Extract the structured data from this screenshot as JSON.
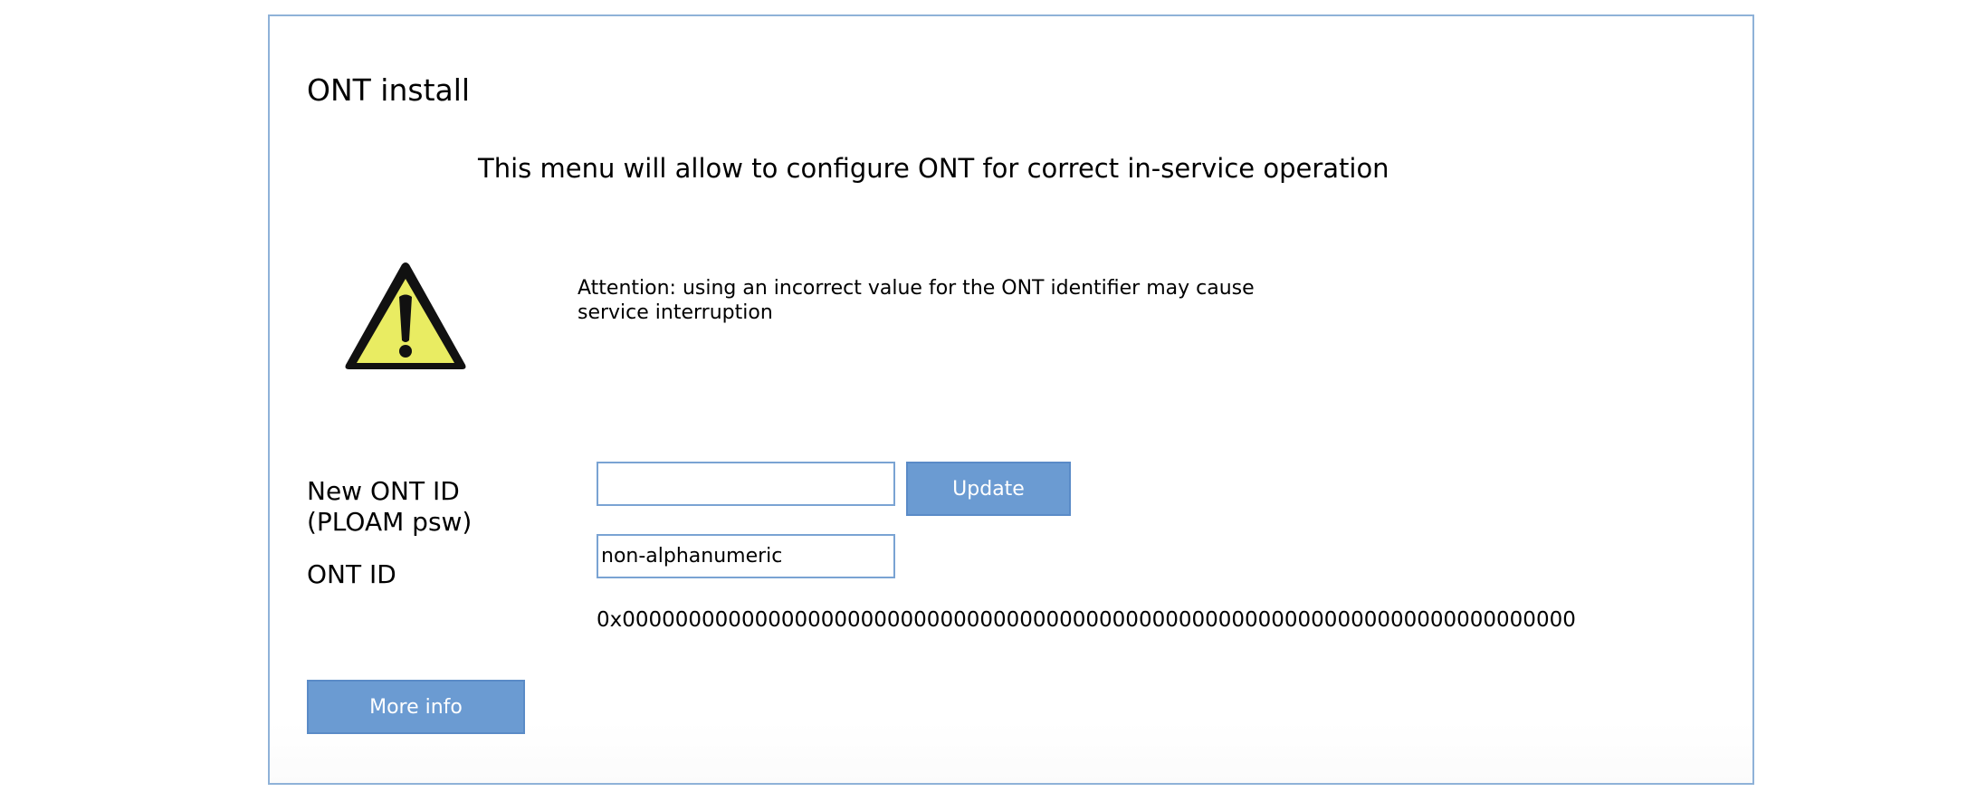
{
  "panel": {
    "title": "ONT install",
    "subtitle": "This menu will allow to configure ONT for correct in-service operation",
    "warning": {
      "icon": "warning-triangle-icon",
      "text": "Attention: using an incorrect value for the ONT identifier may cause service interruption"
    }
  },
  "form": {
    "new_ont_id_label": "New ONT ID (PLOAM psw)",
    "new_ont_id_value": "",
    "update_label": "Update",
    "ont_id_label": "ONT ID",
    "ont_id_value": "non-alphanumeric",
    "ont_id_hex": "0x000000000000000000000000000000000000000000000000000000000000000000000000"
  },
  "footer": {
    "more_info_label": "More info"
  },
  "colors": {
    "border": "#8fb2d8",
    "button": "#6b9bd2",
    "warning_fill": "#e9ec62"
  }
}
